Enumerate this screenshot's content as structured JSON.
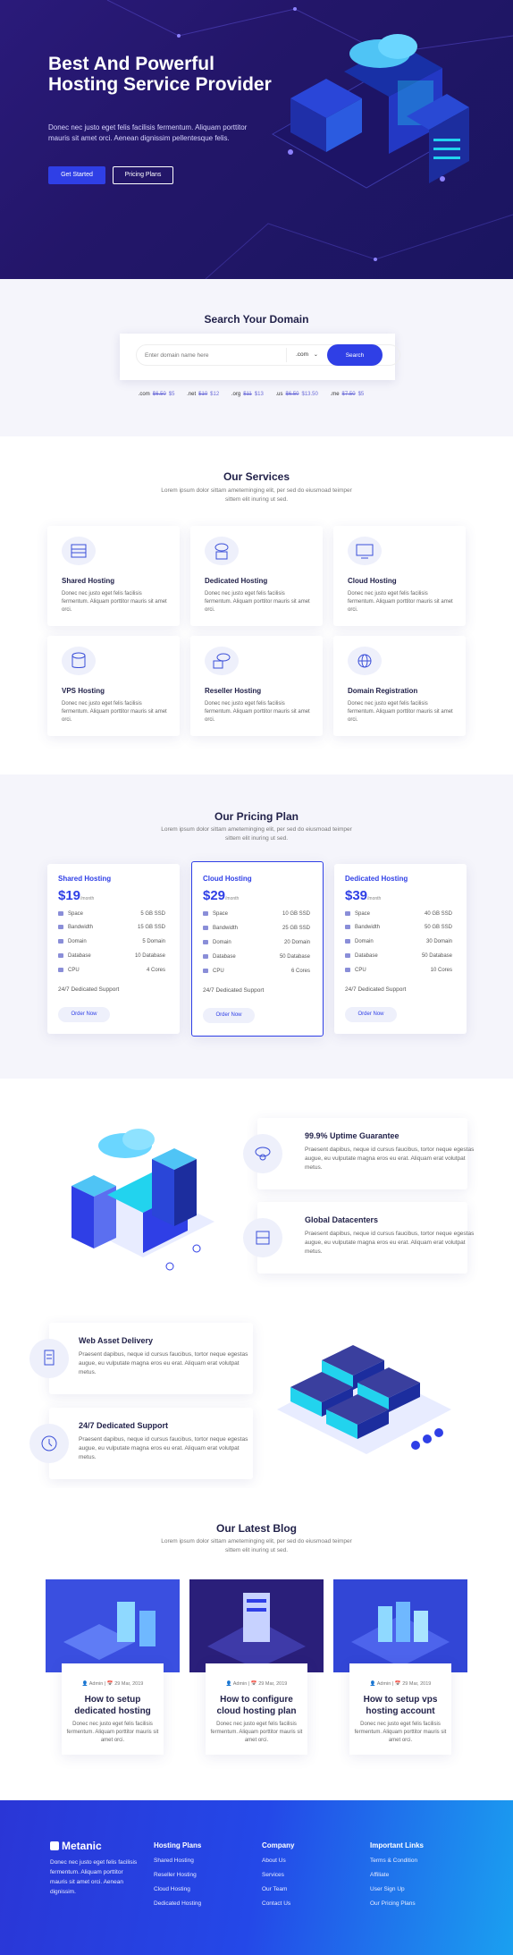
{
  "hero": {
    "title": "Best And Powerful Hosting Service Provider",
    "description": "Donec nec justo eget felis facilisis fermentum. Aliquam porttitor mauris sit amet orci. Aenean dignissim pellentesque felis.",
    "cta_primary": "Get Started",
    "cta_secondary": "Pricing Plans"
  },
  "search": {
    "title": "Search Your Domain",
    "placeholder": "Enter domain name here",
    "tld_selected": ".com",
    "button": "Search",
    "tlds": [
      {
        "ext": ".com",
        "old": "$6.50",
        "new": "$5"
      },
      {
        "ext": ".net",
        "old": "$10",
        "new": "$12"
      },
      {
        "ext": ".org",
        "old": "$11",
        "new": "$13"
      },
      {
        "ext": ".us",
        "old": "$6.50",
        "new": "$13.50"
      },
      {
        "ext": ".me",
        "old": "$7.50",
        "new": "$5"
      }
    ]
  },
  "services": {
    "title": "Our Services",
    "subtitle": "Lorem ipsum dolor sittam ameteminging elit, per sed do eiusmoad teimper sittem elit inuring ut sed.",
    "items": [
      {
        "icon": "server-icon",
        "title": "Shared Hosting",
        "desc": "Donec nec justo eget felis facilisis fermentum. Aliquam porttitor mauris sit amet orci."
      },
      {
        "icon": "cloud-server-icon",
        "title": "Dedicated Hosting",
        "desc": "Donec nec justo eget felis facilisis fermentum. Aliquam porttitor mauris sit amet orci."
      },
      {
        "icon": "monitor-icon",
        "title": "Cloud Hosting",
        "desc": "Donec nec justo eget felis facilisis fermentum. Aliquam porttitor mauris sit amet orci."
      },
      {
        "icon": "database-icon",
        "title": "VPS Hosting",
        "desc": "Donec nec justo eget felis facilisis fermentum. Aliquam porttitor mauris sit amet orci."
      },
      {
        "icon": "reseller-icon",
        "title": "Reseller Hosting",
        "desc": "Donec nec justo eget felis facilisis fermentum. Aliquam porttitor mauris sit amet orci."
      },
      {
        "icon": "globe-icon",
        "title": "Domain Registration",
        "desc": "Donec nec justo eget felis facilisis fermentum. Aliquam porttitor mauris sit amet orci."
      }
    ]
  },
  "pricing": {
    "title": "Our Pricing Plan",
    "subtitle": "Lorem ipsum dolor sittam ameteminging elit, per sed do eiusmoad teimper sittem elit inuring ut sed.",
    "per": "/month",
    "support": "24/7 Dedicated Support",
    "order": "Order Now",
    "plans": [
      {
        "name": "Shared Hosting",
        "price": "$19",
        "features": [
          [
            "Space",
            "5 GB SSD"
          ],
          [
            "Bandwidth",
            "15 GB SSD"
          ],
          [
            "Domain",
            "5 Domain"
          ],
          [
            "Database",
            "10 Database"
          ],
          [
            "CPU",
            "4 Cores"
          ]
        ]
      },
      {
        "name": "Cloud Hosting",
        "price": "$29",
        "features": [
          [
            "Space",
            "10 GB SSD"
          ],
          [
            "Bandwidth",
            "25 GB SSD"
          ],
          [
            "Domain",
            "20 Domain"
          ],
          [
            "Database",
            "50 Database"
          ],
          [
            "CPU",
            "6 Cores"
          ]
        ]
      },
      {
        "name": "Dedicated Hosting",
        "price": "$39",
        "features": [
          [
            "Space",
            "40 GB SSD"
          ],
          [
            "Bandwidth",
            "50 GB SSD"
          ],
          [
            "Domain",
            "30 Domain"
          ],
          [
            "Database",
            "50 Database"
          ],
          [
            "CPU",
            "10 Cores"
          ]
        ]
      }
    ]
  },
  "features": [
    {
      "icon": "cloud-gear-icon",
      "title": "99.9% Uptime Guarantee",
      "desc": "Praesent dapibus, neque id cursus faucibus, tortor neque egestas augue, eu vulputate magna eros eu erat. Aliquam erat volutpat metus."
    },
    {
      "icon": "network-icon",
      "title": "Global Datacenters",
      "desc": "Praesent dapibus, neque id cursus faucibus, tortor neque egestas augue, eu vulputate magna eros eu erat. Aliquam erat volutpat metus."
    },
    {
      "icon": "document-icon",
      "title": "Web Asset Delivery",
      "desc": "Praesent dapibus, neque id cursus faucibus, tortor neque egestas augue, eu vulputate magna eros eu erat. Aliquam erat volutpat metus."
    },
    {
      "icon": "support-icon",
      "title": "24/7 Dedicated Support",
      "desc": "Praesent dapibus, neque id cursus faucibus, tortor neque egestas augue, eu vulputate magna eros eu erat. Aliquam erat volutpat metus."
    }
  ],
  "blog": {
    "title": "Our Latest Blog",
    "subtitle": "Lorem ipsum dolor sittam ameteminging elit, per sed do eiusmoad teimper sittem elit inuring ut sed.",
    "posts": [
      {
        "author": "Admin",
        "date": "29 Mar, 2019",
        "title": "How to setup dedicated hosting",
        "desc": "Donec nec justo eget felis facilisis fermentum. Aliquam porttitor mauris sit amet orci."
      },
      {
        "author": "Admin",
        "date": "29 Mar, 2019",
        "title": "How to configure cloud hosting plan",
        "desc": "Donec nec justo eget felis facilisis fermentum. Aliquam porttitor mauris sit amet orci."
      },
      {
        "author": "Admin",
        "date": "29 Mar, 2019",
        "title": "How to setup vps hosting account",
        "desc": "Donec nec justo eget felis facilisis fermentum. Aliquam porttitor mauris sit amet orci."
      }
    ]
  },
  "footer": {
    "brand": "Metanic",
    "about": "Donec nec justo eget felis facilisis fermentum. Aliquam porttitor mauris sit amet orci. Aenean dignissim.",
    "columns": [
      {
        "title": "Hosting Plans",
        "links": [
          "Shared Hosting",
          "Reseller Hosting",
          "Cloud Hosting",
          "Dedicated Hosting"
        ]
      },
      {
        "title": "Company",
        "links": [
          "About Us",
          "Services",
          "Our Team",
          "Contact Us"
        ]
      },
      {
        "title": "Important Links",
        "links": [
          "Terms & Condition",
          "Affiliate",
          "User Sign Up",
          "Our Pricing Plans"
        ]
      }
    ]
  },
  "colors": {
    "primary": "#2f3fe6",
    "hero_bg": "#231669",
    "accent": "#22d3ee"
  }
}
